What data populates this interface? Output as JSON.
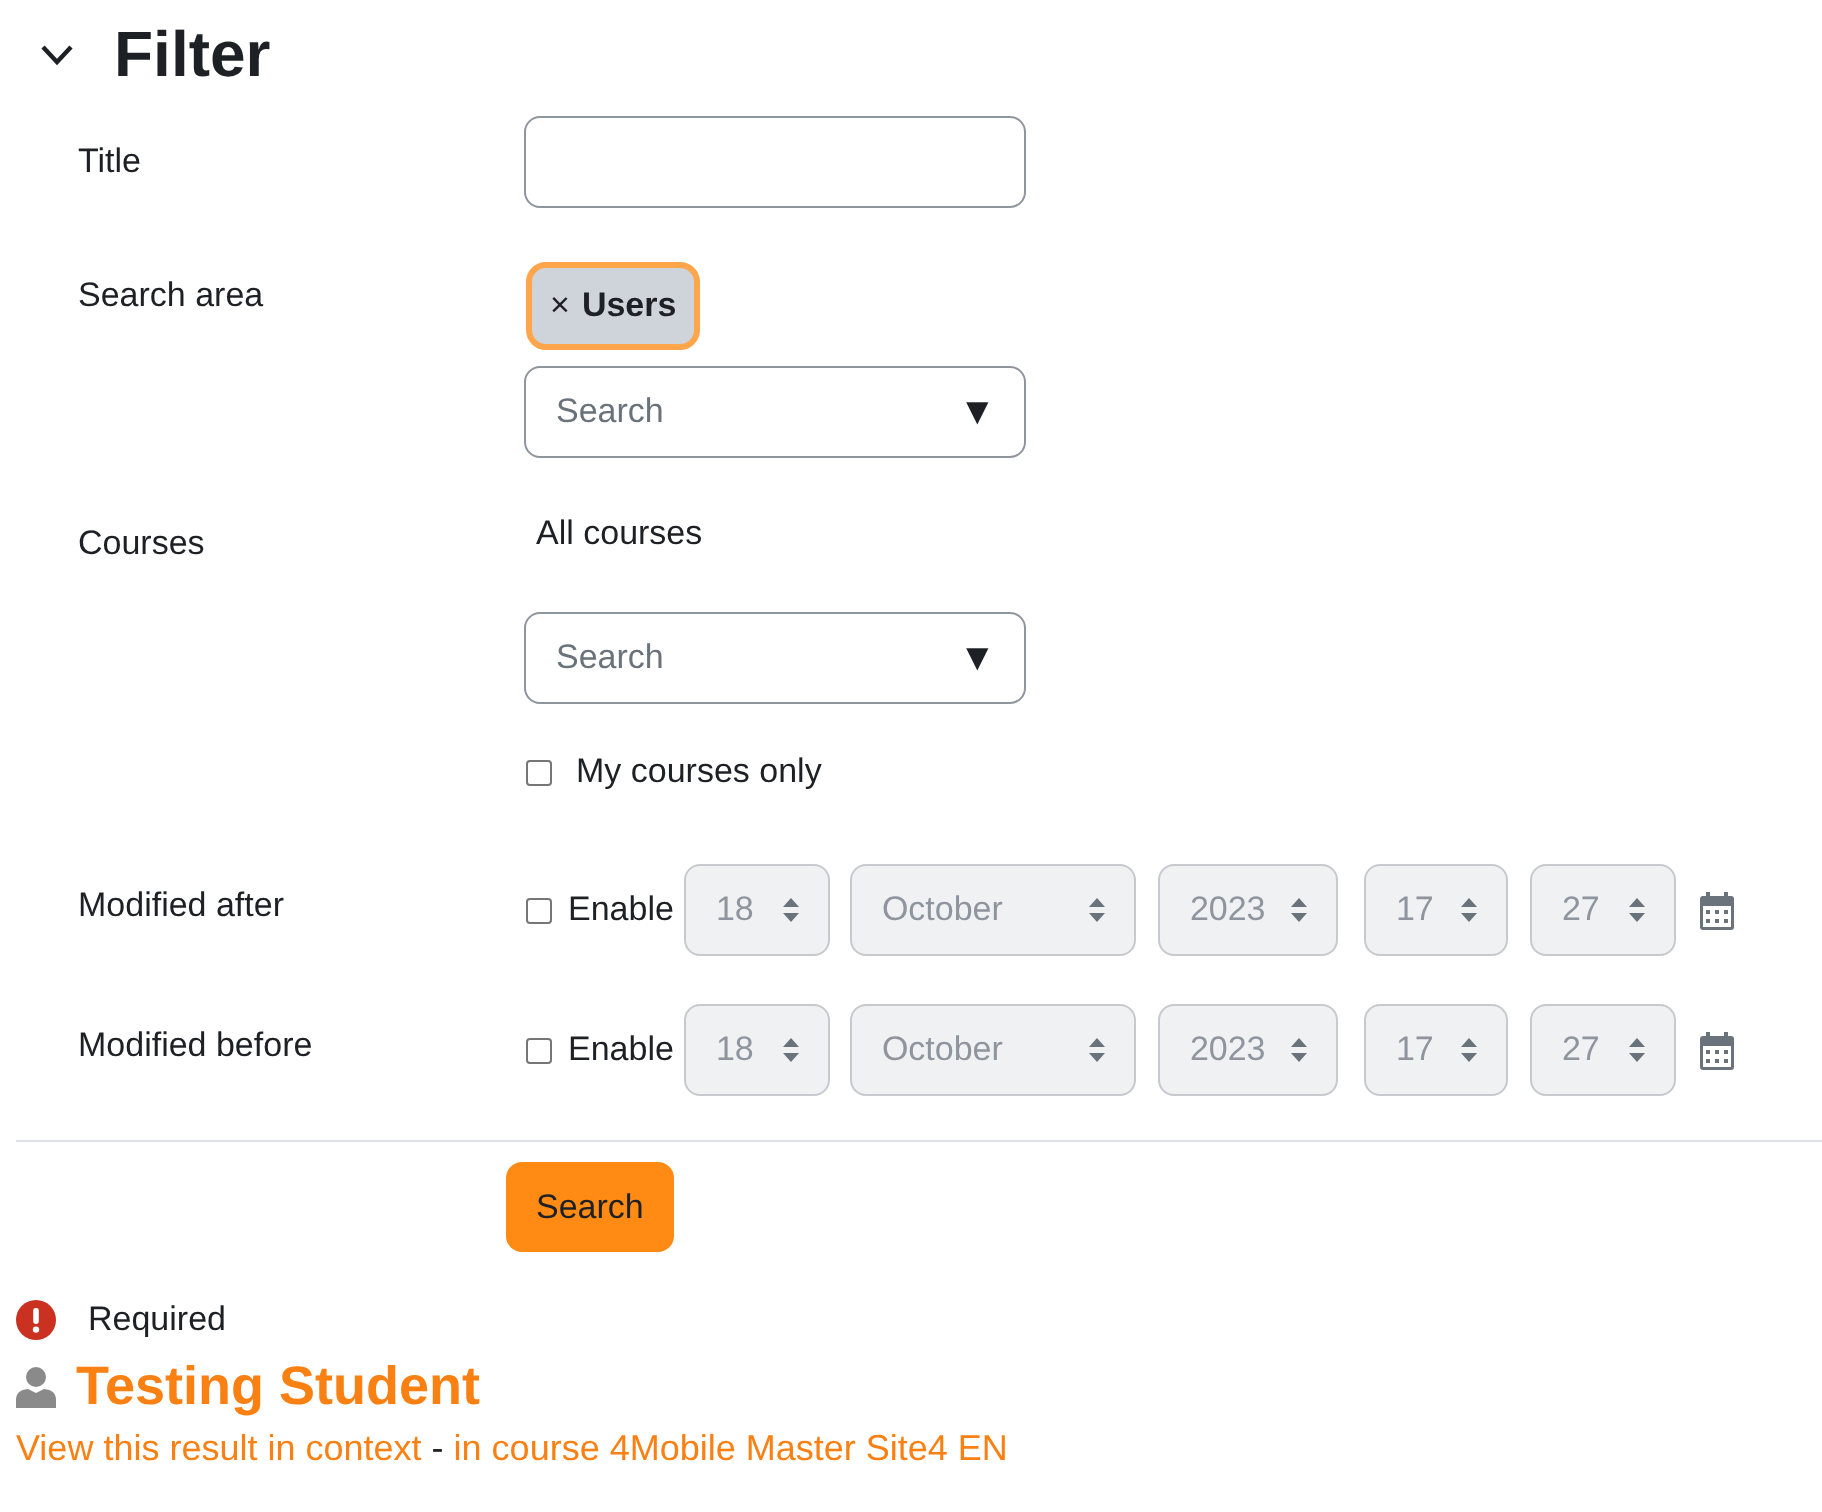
{
  "filter": {
    "title": "Filter",
    "expanded": true,
    "fields": [
      {
        "kind": "text",
        "label": "Title"
      },
      {
        "kind": "autocomplete",
        "label": "Search area",
        "tags": [
          {
            "remove": "×",
            "label": "Users",
            "focused": true
          }
        ],
        "placeholder": "Search",
        "arrow": "▼"
      },
      {
        "kind": "autocomplete",
        "label": "Courses",
        "selection": "All courses",
        "placeholder": "Search",
        "arrow": "▼",
        "options": [
          {
            "label": "My courses only",
            "checked": false
          }
        ]
      },
      {
        "kind": "date",
        "label": "Modified after",
        "enable": {
          "label": "Enable",
          "checked": false
        },
        "parts": [
          "18",
          "October",
          "2023",
          "17",
          "27"
        ]
      },
      {
        "kind": "date",
        "label": "Modified before",
        "enable": {
          "label": "Enable",
          "checked": false
        },
        "parts": [
          "18",
          "October",
          "2023",
          "17",
          "27"
        ]
      }
    ],
    "submit": "Search",
    "required_note": "Required"
  },
  "results": [
    {
      "title": "Testing Student",
      "context_link": "View this result in context",
      "separator": "-",
      "course_link": "in course 4Mobile Master Site4 EN"
    }
  ]
}
